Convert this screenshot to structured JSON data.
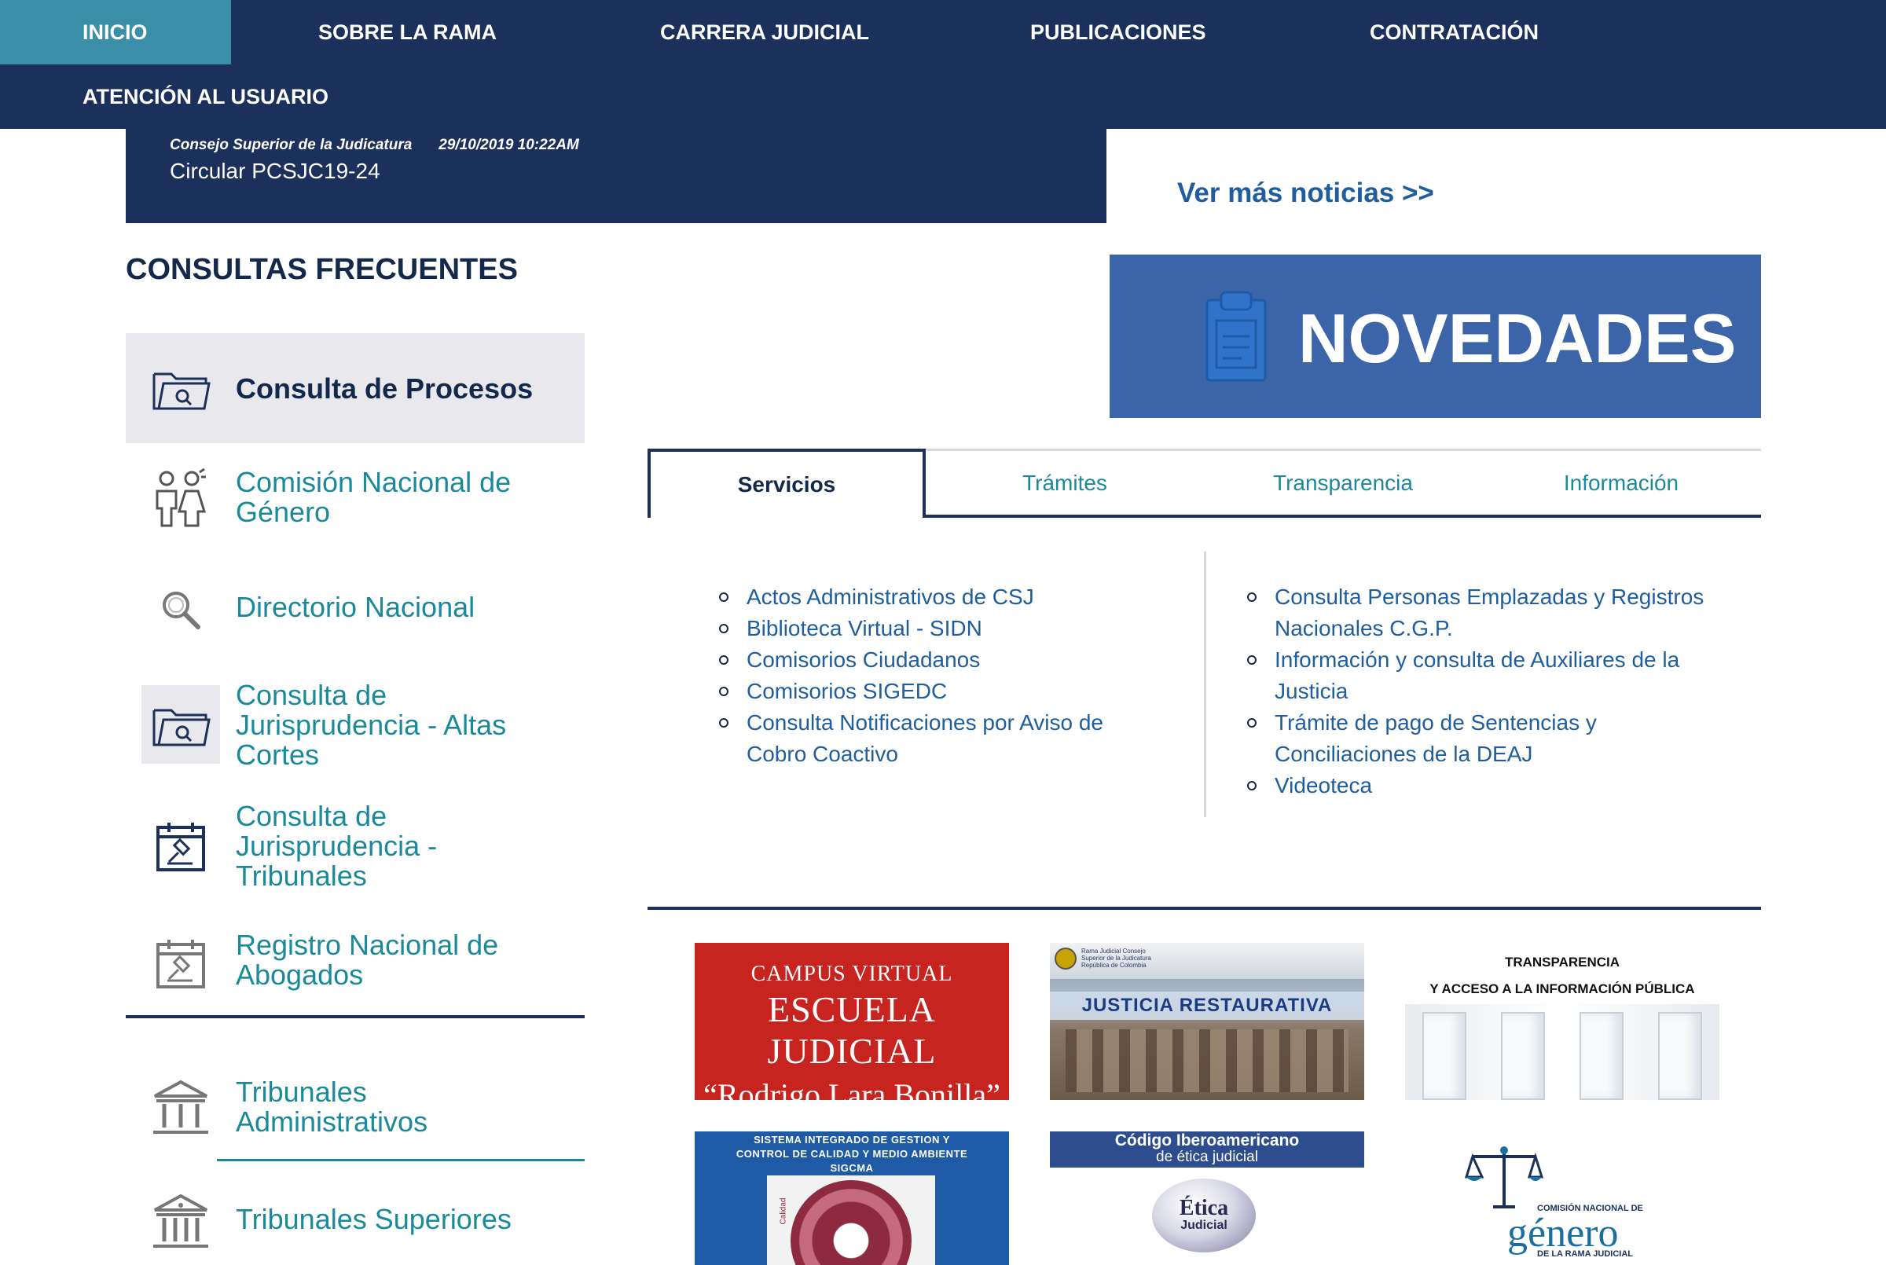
{
  "nav": {
    "items": [
      {
        "label": "INICIO",
        "active": true
      },
      {
        "label": "SOBRE LA RAMA"
      },
      {
        "label": "CARRERA JUDICIAL"
      },
      {
        "label": "PUBLICACIONES"
      },
      {
        "label": "CONTRATACIÓN"
      },
      {
        "label": "ATENCIÓN AL USUARIO"
      }
    ]
  },
  "news": {
    "source": "Consejo Superior de la Judicatura",
    "datetime": "29/10/2019 10:22AM",
    "title": "Circular PCSJC19-24",
    "more_link": "Ver más noticias >>"
  },
  "consultas": {
    "title": "CONSULTAS FRECUENTES",
    "items": [
      {
        "label": "Consulta de Procesos",
        "icon": "folder-search-icon"
      },
      {
        "label": "Comisión Nacional de Género",
        "icon": "gender-people-icon"
      },
      {
        "label": "Directorio Nacional",
        "icon": "magnifier-icon"
      },
      {
        "label": "Consulta de Jurisprudencia - Altas Cortes",
        "icon": "folder-search-icon"
      },
      {
        "label": "Consulta de Jurisprudencia - Tribunales",
        "icon": "calendar-gavel-icon"
      },
      {
        "label": "Registro Nacional de Abogados",
        "icon": "calendar-gavel-icon"
      },
      {
        "label": "Tribunales Administrativos",
        "icon": "courthouse-icon"
      },
      {
        "label": "Tribunales Superiores",
        "icon": "courthouse-icon"
      }
    ]
  },
  "novedades": {
    "label": "NOVEDADES",
    "icon": "clipboard-icon",
    "color": "#3b64a9"
  },
  "tabs": [
    {
      "label": "Servicios",
      "active": true
    },
    {
      "label": "Trámites"
    },
    {
      "label": "Transparencia"
    },
    {
      "label": "Información"
    }
  ],
  "services": {
    "left": [
      "Actos Administrativos de CSJ",
      "Biblioteca Virtual - SIDN",
      "Comisorios Ciudadanos",
      "Comisorios SIGEDC",
      "Consulta Notificaciones por Aviso de Cobro Coactivo"
    ],
    "right": [
      "Consulta Personas Emplazadas y Registros Nacionales C.G.P.",
      "Información y consulta de Auxiliares de la Justicia",
      "Trámite de pago de Sentencias y Conciliaciones de la DEAJ",
      "Videoteca"
    ]
  },
  "banners": {
    "campus": {
      "line1": "CAMPUS VIRTUAL",
      "line2": "ESCUELA JUDICIAL",
      "line3": "“Rodrigo Lara Bonilla”"
    },
    "justicia": {
      "label": "JUSTICIA RESTAURATIVA",
      "header": "Rama Judicial Consejo Superior de la Judicatura República de Colombia"
    },
    "transparencia": {
      "line1": "TRANSPARENCIA",
      "line2": "Y ACCESO A LA INFORMACIÓN PÚBLICA"
    },
    "sigcma": {
      "line1": "SISTEMA INTEGRADO DE GESTION Y",
      "line2": "CONTROL DE CALIDAD Y MEDIO AMBIENTE",
      "line3": "SIGCMA",
      "side": "Calidad"
    },
    "etica": {
      "line1": "Código Iberoamericano",
      "line2": "de ética judicial",
      "globe1": "Ética",
      "globe2": "Judicial"
    },
    "genero": {
      "line1": "COMISIÓN NACIONAL DE",
      "line2": "género",
      "line3": "DE LA RAMA JUDICIAL"
    }
  },
  "colors": {
    "navy": "#1b305a",
    "teal": "#1a8a9a",
    "active_nav": "#3a8ea7",
    "link_blue": "#1e5e9f"
  }
}
